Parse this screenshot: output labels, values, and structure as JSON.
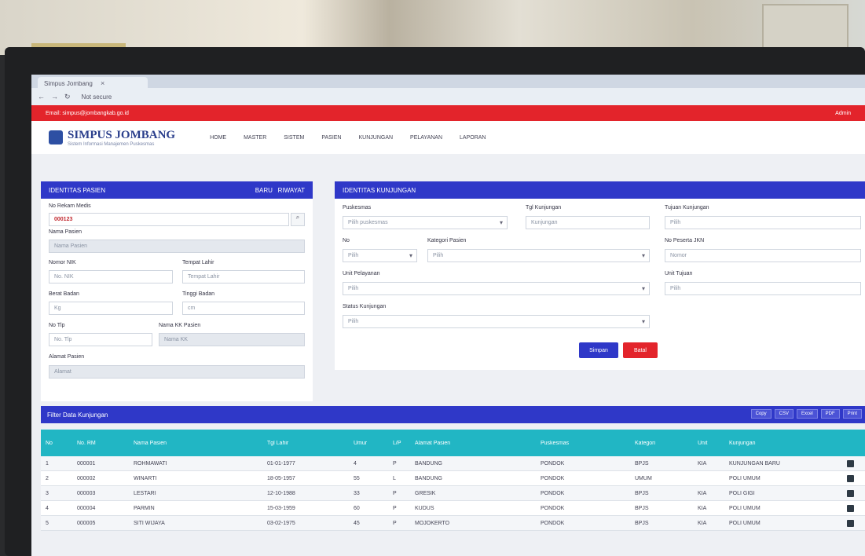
{
  "browser": {
    "tab_title": "Simpus Jombang",
    "url": "Not secure"
  },
  "topbar": {
    "contact": "Email: simpus@jombangkab.go.id",
    "user": "Admin"
  },
  "app": {
    "logo_name": "SIMPUS JOMBANG",
    "logo_sub": "Sistem Informasi Manajemen Puskesmas",
    "menu": [
      "HOME",
      "MASTER",
      "SISTEM",
      "PASIEN",
      "KUNJUNGAN",
      "PELAYANAN",
      "LAPORAN"
    ]
  },
  "left_panel": {
    "title": "IDENTITAS PASIEN",
    "actions": [
      "BARU",
      "RIWAYAT"
    ],
    "rm_label": "No Rekam Medis",
    "rm_value": "000123",
    "nama_label": "Nama Pasien",
    "nama_value": "Nama Pasien",
    "nik_label": "Nomor NIK",
    "nik_value": "No. NIK",
    "tempat_label": "Tempat Lahir",
    "tempat_value": "Tempat Lahir",
    "berat_label": "Berat Badan",
    "berat_value": "Kg",
    "tinggi_label": "Tinggi Badan",
    "tinggi_value": "cm",
    "telp_label": "No Tlp",
    "telp_value": "No. Tlp",
    "kk_label": "Nama KK Pasien",
    "kk_value": "Nama KK",
    "alamat_label": "Alamat Pasien",
    "alamat_value": "Alamat"
  },
  "right_panel": {
    "title": "IDENTITAS KUNJUNGAN",
    "faskes_label": "Puskesmas",
    "faskes_value": "Pilih puskesmas",
    "tgl_label": "Tgl Kunjungan",
    "tgl_value": "Kunjungan",
    "tujuan_label": "Tujuan Kunjungan",
    "tujuan_value": "Pilih",
    "nik2_label": "No",
    "nik2_value": "Pilih",
    "kategori_label": "Kategori Pasien",
    "kategori_value": "Pilih",
    "nopeserta_label": "No Peserta JKN",
    "nopeserta_value": "Nomor",
    "unit_label": "Unit Pelayanan",
    "unit_value": "Pilih",
    "unittujuan_label": "Unit Tujuan",
    "unittujuan_value": "Pilih",
    "status_label": "Status Kunjungan",
    "status_value": "Pilih",
    "save_label": "Simpan",
    "cancel_label": "Batal"
  },
  "filter": {
    "title": "Filter Data Kunjungan",
    "exports": [
      "Copy",
      "CSV",
      "Excel",
      "PDF",
      "Print"
    ]
  },
  "table": {
    "headers": [
      "No",
      "No. RM",
      "Nama Pasien",
      "Tgl Lahir",
      "Umur",
      "L/P",
      "Alamat Pasien",
      "Puskesmas",
      "Kategori",
      "Unit",
      "Kunjungan"
    ],
    "rows": [
      [
        "1",
        "000001",
        "ROHMAWATI",
        "01-01-1977",
        "4",
        "P",
        "BANDUNG",
        "PONDOK",
        "BPJS",
        "KIA",
        "KUNJUNGAN BARU"
      ],
      [
        "2",
        "000002",
        "WINARTI",
        "18-05-1957",
        "55",
        "L",
        "BANDUNG",
        "PONDOK",
        "UMUM",
        "",
        "POLI UMUM"
      ],
      [
        "3",
        "000003",
        "LESTARI",
        "12-10-1988",
        "33",
        "P",
        "GRESIK",
        "PONDOK",
        "BPJS",
        "KIA",
        "POLI GIGI"
      ],
      [
        "4",
        "000004",
        "PARMIN",
        "15-03-1959",
        "60",
        "P",
        "KUDUS",
        "PONDOK",
        "BPJS",
        "KIA",
        "POLI UMUM"
      ],
      [
        "5",
        "000005",
        "SITI WIJAYA",
        "03-02-1975",
        "45",
        "P",
        "MOJOKERTO",
        "PONDOK",
        "BPJS",
        "KIA",
        "POLI UMUM"
      ]
    ]
  }
}
